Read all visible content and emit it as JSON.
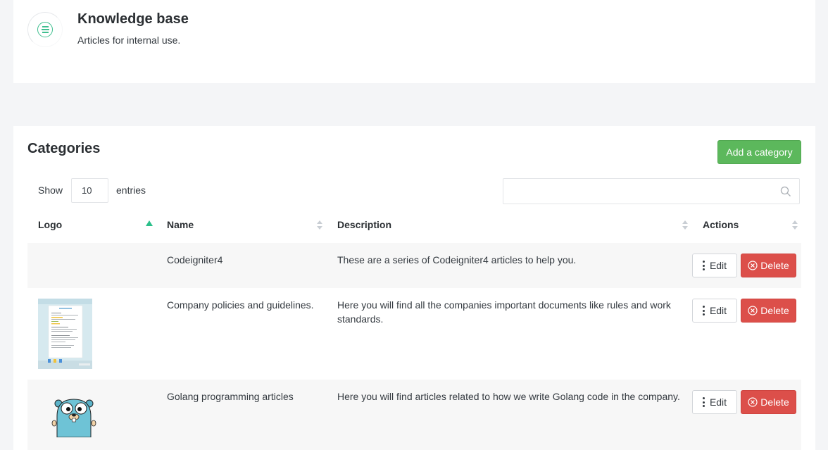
{
  "header": {
    "title": "Knowledge base",
    "subtitle": "Articles for internal use."
  },
  "categories_card": {
    "title": "Categories",
    "add_button_label": "Add a category",
    "show_label": "Show",
    "entries_value": "10",
    "entries_label": "entries",
    "search_value": "",
    "columns": [
      "Logo",
      "Name",
      "Description",
      "Actions"
    ],
    "rows": [
      {
        "logo": "",
        "name": "Codeigniter4",
        "description": "These are a series of Codeigniter4 articles to help you.",
        "edit_label": "Edit",
        "delete_label": "Delete"
      },
      {
        "logo": "document-thumbnail",
        "name": "Company policies and guidelines.",
        "description": "Here you will find all the companies important documents like rules and work standards.",
        "edit_label": "Edit",
        "delete_label": "Delete"
      },
      {
        "logo": "gopher-mascot",
        "name": "Golang programming articles",
        "description": "Here you will find articles related to how we write Golang code in the company.",
        "edit_label": "Edit",
        "delete_label": "Delete"
      }
    ]
  },
  "colors": {
    "accent_green": "#5cb85c",
    "danger_red": "#dc4f4a",
    "sort_active": "#2bbf8a"
  }
}
